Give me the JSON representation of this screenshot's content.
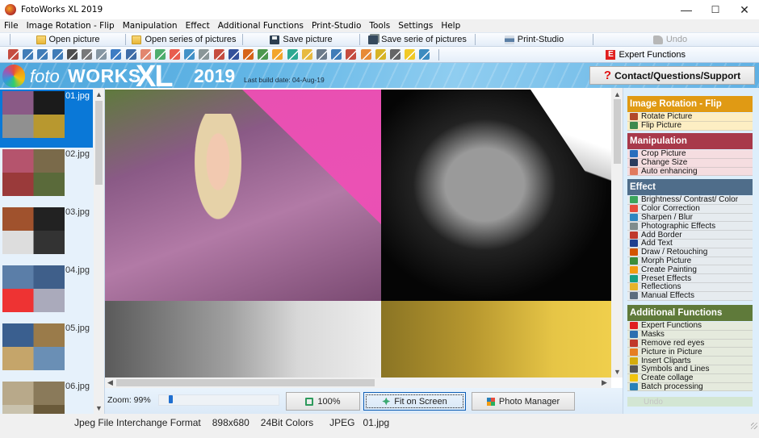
{
  "window": {
    "title": "FotoWorks XL 2019",
    "controls": {
      "minimize": "—",
      "maximize": "☐",
      "close": "✕"
    }
  },
  "menu": [
    "File",
    "Image Rotation - Flip",
    "Manipulation",
    "Effect",
    "Additional Functions",
    "Print-Studio",
    "Tools",
    "Settings",
    "Help"
  ],
  "toolbar": {
    "open_picture": "Open picture",
    "open_series": "Open series of pictures",
    "save_picture": "Save picture",
    "save_series": "Save serie of pictures",
    "print_studio": "Print-Studio",
    "undo": "Undo"
  },
  "iconbar": {
    "icons": [
      "rotate-left-icon",
      "rotate-right-icon",
      "rotate-ccw-icon",
      "rotate-cw-icon",
      "flip-vertical-icon",
      "flip-horizontal-icon",
      "perspective-icon",
      "crop-icon",
      "resize-icon",
      "auto-enhance-icon",
      "brightness-icon",
      "color-correction-icon",
      "sharpen-icon",
      "photo-effects-icon",
      "border-icon",
      "text-icon",
      "draw-icon",
      "morph-icon",
      "painting-icon",
      "preset-effects-icon",
      "reflections-icon",
      "manual-effects-icon",
      "masks-icon",
      "red-eye-icon",
      "picture-in-picture-icon",
      "cliparts-icon",
      "symbols-icon",
      "collage-icon",
      "batch-icon"
    ],
    "colors": [
      "#c0392b",
      "#2c6fb0",
      "#2c6fb0",
      "#2c6fb0",
      "#3a3a3a",
      "#6b6b6b",
      "#7a8c99",
      "#2a6ebd",
      "#2b5d9e",
      "#e07a5f",
      "#3ba55c",
      "#e74c3c",
      "#2e86c1",
      "#7f8c8d",
      "#c0392b",
      "#1f3f8f",
      "#d35400",
      "#3b8d3b",
      "#f39c12",
      "#16a085",
      "#e6b32b",
      "#5d6d7e",
      "#2c6fb0",
      "#c0392b",
      "#e67e22",
      "#d4ac0d",
      "#555555",
      "#f1c40f",
      "#2980b9"
    ],
    "expert": {
      "badge": "E",
      "label": "Expert Functions"
    }
  },
  "banner": {
    "logo_foto": "foto",
    "logo_works": "WORKS",
    "logo_xl": "XL",
    "logo_year": "2019",
    "build_date": "Last build date: 04-Aug-19",
    "support_icon": "?",
    "support_label": "Contact/Questions/Support"
  },
  "thumbnails": [
    {
      "name": "01.jpg",
      "selected": true,
      "colors": [
        "#8a5a86",
        "#1b1b1b",
        "#909090",
        "#b8982f"
      ]
    },
    {
      "name": "02.jpg",
      "selected": false,
      "colors": [
        "#b5546d",
        "#7a6a4a",
        "#9a3a3a",
        "#5a6a3a"
      ]
    },
    {
      "name": "03.jpg",
      "selected": false,
      "colors": [
        "#a0522d",
        "#222",
        "#ddd",
        "#333"
      ]
    },
    {
      "name": "04.jpg",
      "selected": false,
      "colors": [
        "#5b7ea8",
        "#3f5f8a",
        "#e33",
        "#aab"
      ]
    },
    {
      "name": "05.jpg",
      "selected": false,
      "colors": [
        "#3a5f8f",
        "#9a7b4a",
        "#c5a56a",
        "#6a8fb5"
      ]
    },
    {
      "name": "06.jpg",
      "selected": false,
      "colors": [
        "#b8a98a",
        "#8a7a5a",
        "#c9c2ad",
        "#6a5a3a"
      ]
    }
  ],
  "viewer": {
    "zoom_label": "Zoom: 99%",
    "zoom_value": 0.99,
    "btn_100": "100%",
    "btn_fit": "Fit on Screen",
    "btn_photo_manager": "Photo Manager"
  },
  "panel": {
    "sections": [
      {
        "title": "Image Rotation - Flip",
        "color": "#e09a14",
        "item_bg": "#fdeec3",
        "items": [
          {
            "label": "Rotate Picture",
            "icon": "rotate-picture-icon",
            "ic": "#b24a2a"
          },
          {
            "label": "Flip Picture",
            "icon": "flip-picture-icon",
            "ic": "#3d8a4d"
          }
        ]
      },
      {
        "title": "Manipulation",
        "color": "#a8394a",
        "item_bg": "#f5dde0",
        "items": [
          {
            "label": "Crop Picture",
            "icon": "crop-icon",
            "ic": "#2a6ebd"
          },
          {
            "label": "Change Size",
            "icon": "resize-icon",
            "ic": "#2b3b5e"
          },
          {
            "label": "Auto enhancing",
            "icon": "auto-enhance-icon",
            "ic": "#e07a5f"
          }
        ]
      },
      {
        "title": "Effect",
        "color": "#4f6d8a",
        "item_bg": "#e6ebef",
        "items": [
          {
            "label": "Brightness/ Contrast/ Color",
            "icon": "brightness-icon",
            "ic": "#3ba55c"
          },
          {
            "label": "Color Correction",
            "icon": "color-correction-icon",
            "ic": "#e74c3c"
          },
          {
            "label": "Sharpen / Blur",
            "icon": "sharpen-icon",
            "ic": "#2e86c1"
          },
          {
            "label": "Photographic Effects",
            "icon": "photo-effects-icon",
            "ic": "#7f8c8d"
          },
          {
            "label": "Add Border",
            "icon": "border-icon",
            "ic": "#c0392b"
          },
          {
            "label": "Add Text",
            "icon": "text-icon",
            "ic": "#1f3f8f"
          },
          {
            "label": "Draw / Retouching",
            "icon": "draw-icon",
            "ic": "#d35400"
          },
          {
            "label": "Morph Picture",
            "icon": "morph-icon",
            "ic": "#3b8d3b"
          },
          {
            "label": "Create Painting",
            "icon": "painting-icon",
            "ic": "#f39c12"
          },
          {
            "label": "Preset Effects",
            "icon": "preset-effects-icon",
            "ic": "#16a085"
          },
          {
            "label": "Reflections",
            "icon": "reflections-icon",
            "ic": "#e6b32b"
          },
          {
            "label": "Manual Effects",
            "icon": "manual-effects-icon",
            "ic": "#5d6d7e"
          }
        ]
      },
      {
        "title": "Additional Functions",
        "color": "#5f7a3a",
        "item_bg": "#e5eadd",
        "items": [
          {
            "label": "Expert Functions",
            "icon": "expert-icon",
            "ic": "#e02020"
          },
          {
            "label": "Masks",
            "icon": "masks-icon",
            "ic": "#2c6fb0"
          },
          {
            "label": "Remove red eyes",
            "icon": "red-eye-icon",
            "ic": "#c0392b"
          },
          {
            "label": "Picture in Picture",
            "icon": "picture-in-picture-icon",
            "ic": "#e67e22"
          },
          {
            "label": "Insert Cliparts",
            "icon": "cliparts-icon",
            "ic": "#d4ac0d"
          },
          {
            "label": "Symbols and Lines",
            "icon": "symbols-icon",
            "ic": "#555555"
          },
          {
            "label": "Create collage",
            "icon": "collage-icon",
            "ic": "#f1c40f"
          },
          {
            "label": "Batch processing",
            "icon": "batch-icon",
            "ic": "#2980b9"
          }
        ]
      }
    ],
    "undo": "Undo"
  },
  "status": {
    "format": "Jpeg File Interchange Format",
    "dimensions": "898x680",
    "colors": "24Bit Colors",
    "type": "JPEG",
    "file": "01.jpg"
  }
}
